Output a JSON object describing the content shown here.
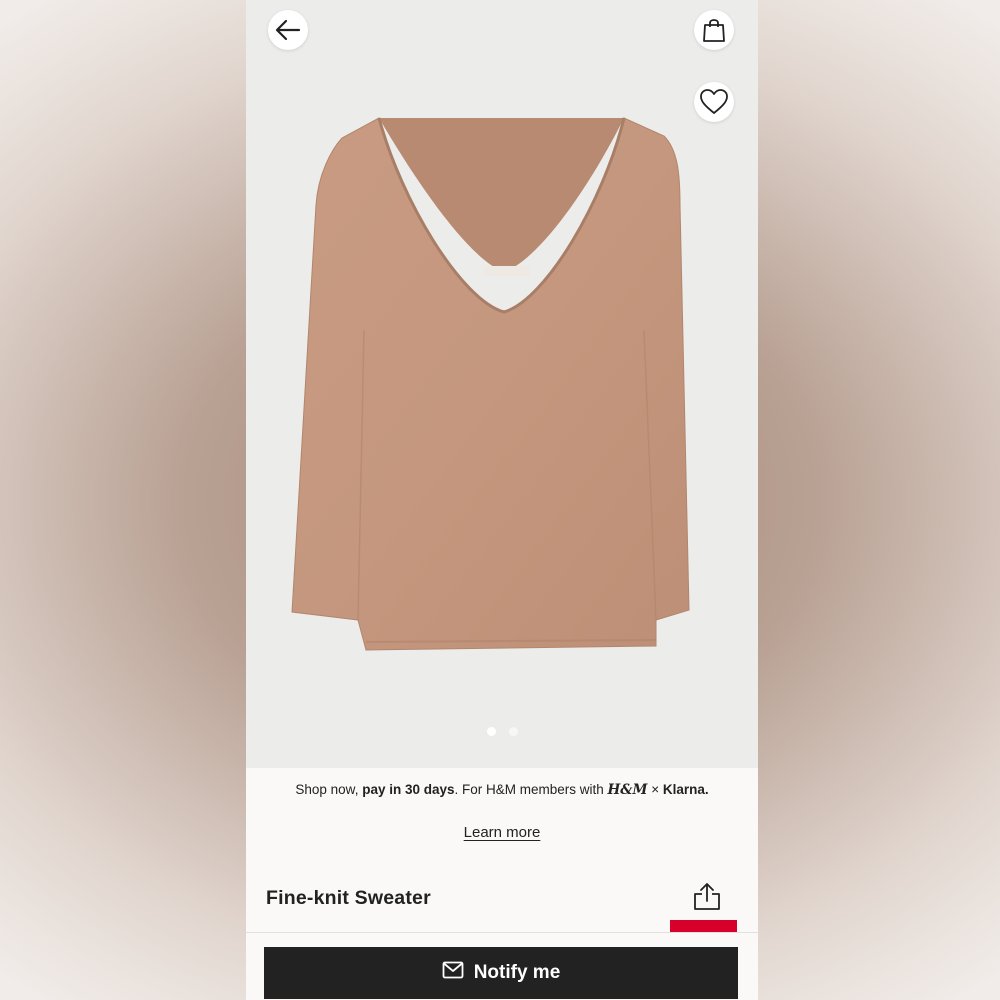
{
  "header": {
    "back_icon": "arrow-left-icon",
    "bag_icon": "shopping-bag-icon",
    "favorite_icon": "heart-icon"
  },
  "gallery": {
    "image": "beige fine-knit v-neck sweater",
    "current_slide": 1,
    "total_slides": 2
  },
  "promo": {
    "prefix": "Shop now, ",
    "highlight": "pay in 30 days",
    "suffix": ". For H&M members with ",
    "hm_logo": "H&M",
    "separator": " × ",
    "klarna": "Klarna."
  },
  "learn_more": "Learn more",
  "product": {
    "title": "Fine-knit Sweater",
    "share_icon": "share-icon"
  },
  "notify": {
    "label": "Notify me",
    "icon": "envelope-icon"
  },
  "colors": {
    "accent_red": "#d6002a",
    "button_dark": "#222222",
    "sweater": "#c6997f"
  }
}
